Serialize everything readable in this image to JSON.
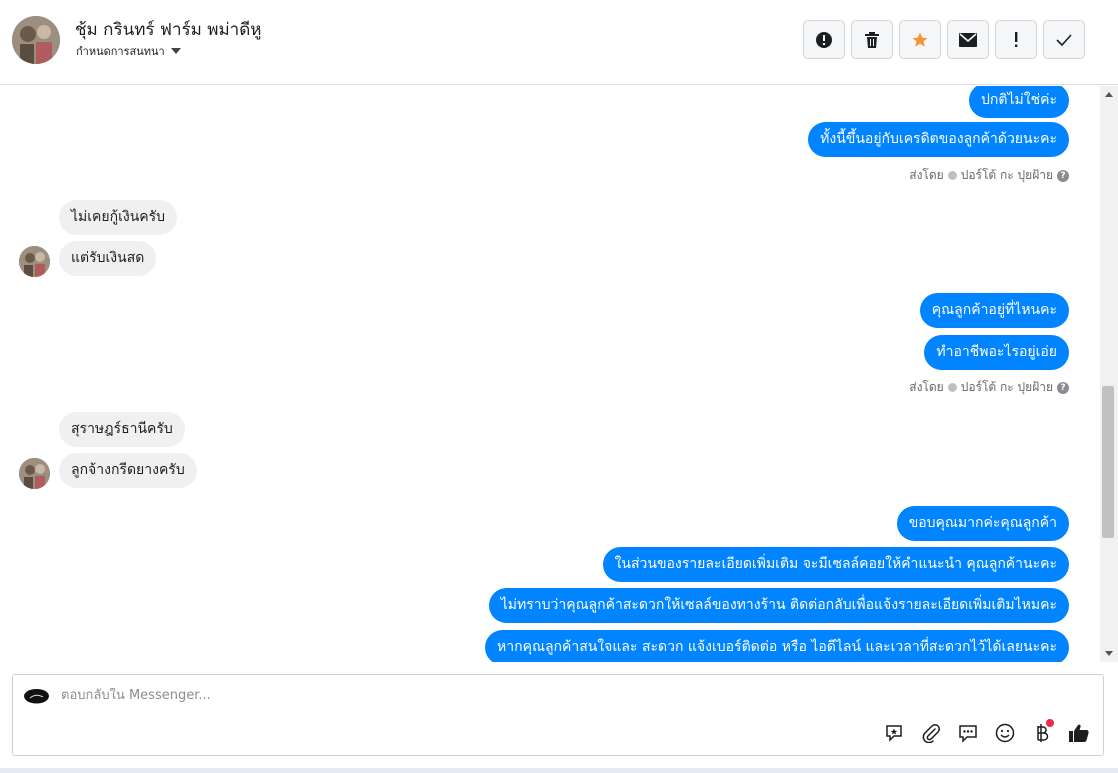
{
  "header": {
    "title": "ชุ้ม กรินทร์ ฟาร์ม พม่าดีหู",
    "subtitle": "กำหนดการสนทนา",
    "toolbar": [
      {
        "name": "spam-alert-button",
        "icon": "alert-circle-icon"
      },
      {
        "name": "delete-button",
        "icon": "trash-icon"
      },
      {
        "name": "star-button",
        "icon": "star-icon"
      },
      {
        "name": "mark-unread-button",
        "icon": "envelope-icon"
      },
      {
        "name": "important-button",
        "icon": "exclamation-icon"
      },
      {
        "name": "done-button",
        "icon": "check-icon"
      }
    ]
  },
  "messages": {
    "out1": "ปกติไม่ใช่ค่ะ",
    "out2": "ทั้งนี้ขึ้นอยู่กับเครดิตของลูกค้าด้วยนะคะ",
    "sent_by_label": "ส่งโดย",
    "sent_by_name": "ปอร์โต้ กะ ปุยฝ้าย",
    "in1": "ไม่เคยกู้เงินครับ",
    "in2": "แต่รับเงินสด",
    "out3": "คุณลูกค้าอยู่ที่ไหนคะ",
    "out4": "ทำอาชีพอะไรอยู่เอ่ย",
    "in3": "สุราษฎร์ธานีครับ",
    "in4": "ลูกจ้างกรีดยางครับ",
    "out5": "ขอบคุณมากค่ะคุณลูกค้า",
    "out6": "ในส่วนของรายละเอียดเพิ่มเติม จะมีเซลล์คอยให้คำแนะนำ คุณลูกค้านะคะ",
    "out7": "ไม่ทราบว่าคุณลูกค้าสะดวกให้เซลล์ของทางร้าน ติดต่อกลับเพื่อแจ้งรายละเอียดเพิ่มเติมไหมคะ",
    "out8": "หากคุณลูกค้าสนใจและ สะดวก แจ้งเบอร์ติดต่อ หรือ ไอดีไลน์ และเวลาที่สะดวกไว้ได้เลยนะคะ"
  },
  "composer": {
    "placeholder": "ตอบกลับใน Messenger...",
    "tools": [
      "sticker-icon",
      "attachment-icon",
      "saved-reply-icon",
      "emoji-icon",
      "baht-payment-icon",
      "thumbs-up-icon"
    ]
  },
  "colors": {
    "outgoing_bubble": "#0084ff",
    "incoming_bubble": "#f0f0f0",
    "star": "#f7923a",
    "notification_dot": "#f02849"
  }
}
